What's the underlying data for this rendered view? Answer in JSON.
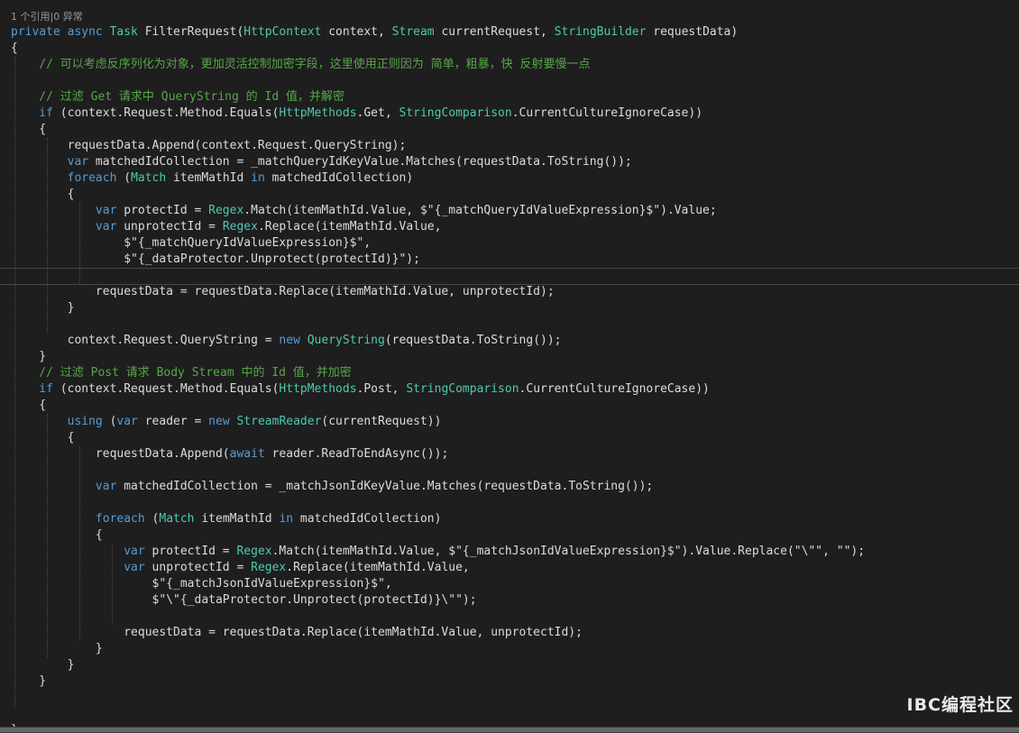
{
  "codelens": "1 个引用|0 异常",
  "watermark": "IBC编程社区",
  "colors": {
    "background": "#1e1e1e",
    "keyword": "#569cd6",
    "type": "#4ec9b0",
    "comment": "#57a64a",
    "text": "#dcdcdc"
  },
  "lines": [
    [
      [
        "kw",
        "private async "
      ],
      [
        "ty",
        "Task"
      ],
      [
        "tx",
        " FilterRequest("
      ],
      [
        "ty",
        "HttpContext"
      ],
      [
        "tx",
        " context, "
      ],
      [
        "ty",
        "Stream"
      ],
      [
        "tx",
        " currentRequest, "
      ],
      [
        "ty",
        "StringBuilder"
      ],
      [
        "tx",
        " requestData)"
      ]
    ],
    [
      [
        "tx",
        "{"
      ]
    ],
    [
      [
        "cm",
        "    // 可以考虑反序列化为对象，更加灵活控制加密字段，这里使用正则因为 简单，粗暴，快 反射要慢一点"
      ]
    ],
    [],
    [
      [
        "cm",
        "    // 过滤 Get 请求中 QueryString 的 Id 值，并解密"
      ]
    ],
    [
      [
        "kw",
        "    if"
      ],
      [
        "tx",
        " (context.Request.Method.Equals("
      ],
      [
        "ty",
        "HttpMethods"
      ],
      [
        "tx",
        ".Get, "
      ],
      [
        "ty",
        "StringComparison"
      ],
      [
        "tx",
        ".CurrentCultureIgnoreCase))"
      ]
    ],
    [
      [
        "tx",
        "    {"
      ]
    ],
    [
      [
        "tx",
        "        requestData.Append(context.Request.QueryString);"
      ]
    ],
    [
      [
        "kw",
        "        var"
      ],
      [
        "tx",
        " matchedIdCollection = _matchQueryIdKeyValue.Matches(requestData.ToString());"
      ]
    ],
    [
      [
        "kw",
        "        foreach"
      ],
      [
        "tx",
        " ("
      ],
      [
        "ty",
        "Match"
      ],
      [
        "tx",
        " itemMathId "
      ],
      [
        "kw",
        "in"
      ],
      [
        "tx",
        " matchedIdCollection)"
      ]
    ],
    [
      [
        "tx",
        "        {"
      ]
    ],
    [
      [
        "kw",
        "            var"
      ],
      [
        "tx",
        " protectId = "
      ],
      [
        "ty",
        "Regex"
      ],
      [
        "tx",
        ".Match(itemMathId.Value, $\"{_matchQueryIdValueExpression}$\").Value;"
      ]
    ],
    [
      [
        "kw",
        "            var"
      ],
      [
        "tx",
        " unprotectId = "
      ],
      [
        "ty",
        "Regex"
      ],
      [
        "tx",
        ".Replace(itemMathId.Value,"
      ]
    ],
    [
      [
        "tx",
        "                $\"{_matchQueryIdValueExpression}$\","
      ]
    ],
    [
      [
        "tx",
        "                $\"{_dataProtector.Unprotect(protectId)}\");"
      ]
    ],
    [],
    [
      [
        "tx",
        "            requestData = requestData.Replace(itemMathId.Value, unprotectId);"
      ]
    ],
    [
      [
        "tx",
        "        }"
      ]
    ],
    [],
    [
      [
        "tx",
        "        context.Request.QueryString = "
      ],
      [
        "kw",
        "new "
      ],
      [
        "ty",
        "QueryString"
      ],
      [
        "tx",
        "(requestData.ToString());"
      ]
    ],
    [
      [
        "tx",
        "    }"
      ]
    ],
    [
      [
        "cm",
        "    // 过滤 Post 请求 Body Stream 中的 Id 值，并加密"
      ]
    ],
    [
      [
        "kw",
        "    if"
      ],
      [
        "tx",
        " (context.Request.Method.Equals("
      ],
      [
        "ty",
        "HttpMethods"
      ],
      [
        "tx",
        ".Post, "
      ],
      [
        "ty",
        "StringComparison"
      ],
      [
        "tx",
        ".CurrentCultureIgnoreCase))"
      ]
    ],
    [
      [
        "tx",
        "    {"
      ]
    ],
    [
      [
        "kw",
        "        using"
      ],
      [
        "tx",
        " ("
      ],
      [
        "kw",
        "var"
      ],
      [
        "tx",
        " reader = "
      ],
      [
        "kw",
        "new "
      ],
      [
        "ty",
        "StreamReader"
      ],
      [
        "tx",
        "(currentRequest))"
      ]
    ],
    [
      [
        "tx",
        "        {"
      ]
    ],
    [
      [
        "tx",
        "            requestData.Append("
      ],
      [
        "kw",
        "await"
      ],
      [
        "tx",
        " reader.ReadToEndAsync());"
      ]
    ],
    [],
    [
      [
        "kw",
        "            var"
      ],
      [
        "tx",
        " matchedIdCollection = _matchJsonIdKeyValue.Matches(requestData.ToString());"
      ]
    ],
    [],
    [
      [
        "kw",
        "            foreach"
      ],
      [
        "tx",
        " ("
      ],
      [
        "ty",
        "Match"
      ],
      [
        "tx",
        " itemMathId "
      ],
      [
        "kw",
        "in"
      ],
      [
        "tx",
        " matchedIdCollection)"
      ]
    ],
    [
      [
        "tx",
        "            {"
      ]
    ],
    [
      [
        "kw",
        "                var"
      ],
      [
        "tx",
        " protectId = "
      ],
      [
        "ty",
        "Regex"
      ],
      [
        "tx",
        ".Match(itemMathId.Value, $\"{_matchJsonIdValueExpression}$\").Value.Replace(\"\\\"\", \"\");"
      ]
    ],
    [
      [
        "kw",
        "                var"
      ],
      [
        "tx",
        " unprotectId = "
      ],
      [
        "ty",
        "Regex"
      ],
      [
        "tx",
        ".Replace(itemMathId.Value,"
      ]
    ],
    [
      [
        "tx",
        "                    $\"{_matchJsonIdValueExpression}$\","
      ]
    ],
    [
      [
        "tx",
        "                    $\"\\\"{_dataProtector.Unprotect(protectId)}\\\"\");"
      ]
    ],
    [],
    [
      [
        "tx",
        "                requestData = requestData.Replace(itemMathId.Value, unprotectId);"
      ]
    ],
    [
      [
        "tx",
        "            }"
      ]
    ],
    [
      [
        "tx",
        "        }"
      ]
    ],
    [
      [
        "tx",
        "    }"
      ]
    ],
    [],
    [],
    [
      [
        "tx",
        "}"
      ]
    ]
  ]
}
